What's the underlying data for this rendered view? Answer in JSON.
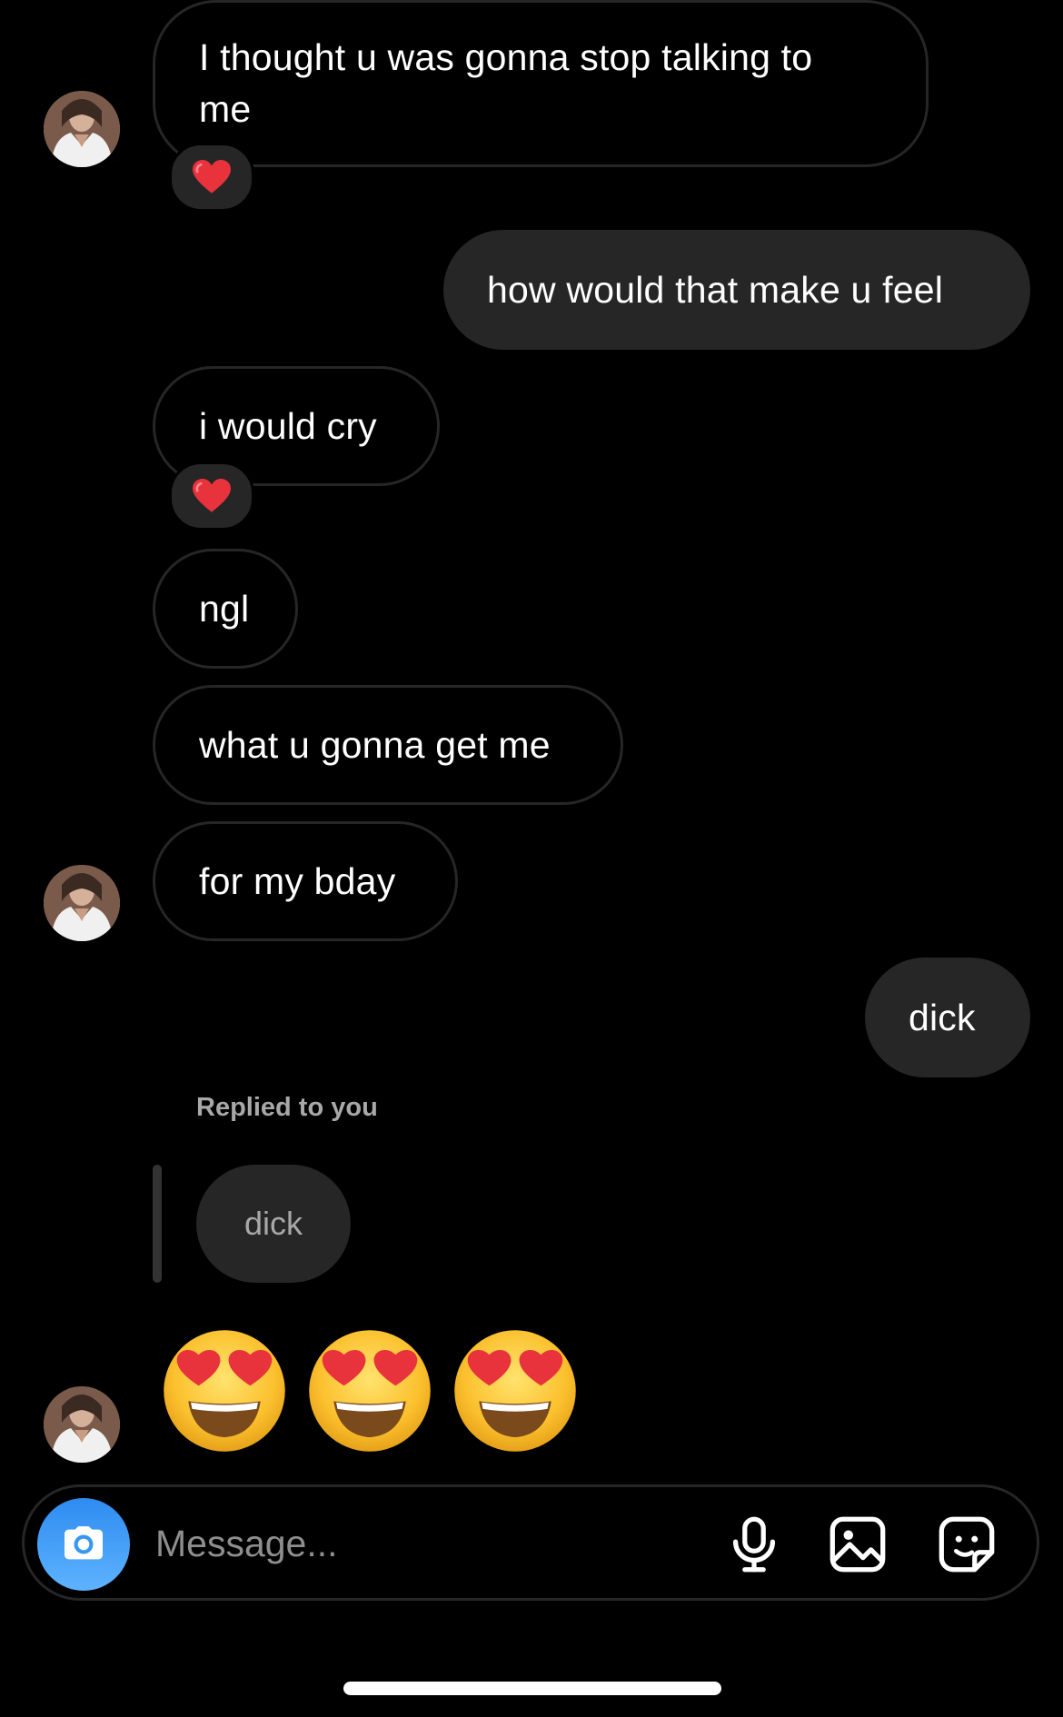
{
  "messages": [
    {
      "text": "I thought u was gonna stop talking to me",
      "line1": "I thought u was gonna stop talking to",
      "line2": "me",
      "direction": "incoming",
      "reaction": "heart"
    },
    {
      "text": "how would that make u feel",
      "direction": "outgoing"
    },
    {
      "text": "i would cry",
      "direction": "incoming",
      "reaction": "heart"
    },
    {
      "text": "ngl",
      "direction": "incoming"
    },
    {
      "text": "what u gonna get me",
      "direction": "incoming"
    },
    {
      "text": "for my bday",
      "direction": "incoming"
    },
    {
      "text": "dick",
      "direction": "outgoing"
    }
  ],
  "reply": {
    "label": "Replied to you",
    "quoted": "dick",
    "emojis": [
      "heart-eyes",
      "heart-eyes",
      "heart-eyes"
    ]
  },
  "composer": {
    "placeholder": "Message...",
    "icons": [
      "camera-icon",
      "microphone-icon",
      "gallery-icon",
      "sticker-icon"
    ]
  },
  "colors": {
    "background": "#000000",
    "outgoing_bubble": "#262626",
    "incoming_border": "#262626",
    "camera_button": "#3897f0",
    "muted_text": "#a8a8a8"
  }
}
